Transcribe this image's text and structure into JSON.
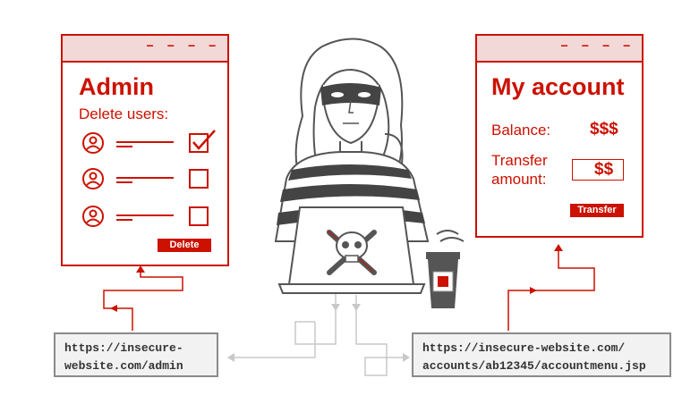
{
  "admin_window": {
    "title": "Admin",
    "subtitle": "Delete users:",
    "users": [
      {
        "checked": true
      },
      {
        "checked": false
      },
      {
        "checked": false
      }
    ],
    "delete_label": "Delete"
  },
  "account_window": {
    "title": "My account",
    "balance_label": "Balance:",
    "balance_value": "$$$",
    "transfer_label_line1": "Transfer",
    "transfer_label_line2": "amount:",
    "transfer_value": "$$",
    "transfer_button": "Transfer"
  },
  "urls": {
    "admin_line1": "https://insecure-",
    "admin_line2": "website.com/admin",
    "account_line1": "https://insecure-website.com/",
    "account_line2": "accounts/ab12345/accountmenu.jsp"
  },
  "colors": {
    "accent": "#cc1100",
    "window_bar": "#f3d8d8",
    "connector_gray": "#c8c8c8",
    "url_border": "#8a8a8a"
  },
  "icons": [
    "user-icon",
    "checkbox-icon",
    "skull-crossbones-icon",
    "coffee-cup-icon",
    "mask-icon"
  ]
}
